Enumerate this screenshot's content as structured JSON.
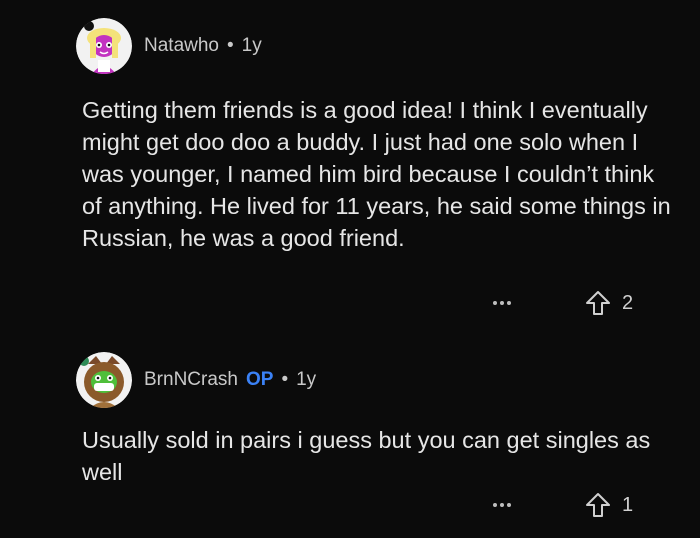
{
  "comments": [
    {
      "username": "Natawho",
      "separator": "•",
      "age": "1y",
      "text": "Getting them friends is a good idea! I think I eventually might get doo doo a buddy. I just had one solo when I was younger, I named him bird because I couldn’t think of anything. He lived for 11 years, he said some things in Russian, he was a good friend.",
      "upvotes": "2",
      "avatar_icon": "pink-character-avatar",
      "more_icon": "more-options-icon",
      "upvote_icon": "upvote-arrow-icon"
    },
    {
      "username": "BrnNCrash",
      "badge": "OP",
      "separator": "•",
      "age": "1y",
      "text": "Usually sold in pairs i guess but you can get singles as well",
      "upvotes": "1",
      "avatar_icon": "frog-owl-avatar",
      "more_icon": "more-options-icon",
      "upvote_icon": "upvote-arrow-icon"
    }
  ],
  "colors": {
    "background": "#0b0b0b",
    "text": "#e6e6e6",
    "username": "#c9c9c9",
    "op_badge": "#3b82f6"
  }
}
